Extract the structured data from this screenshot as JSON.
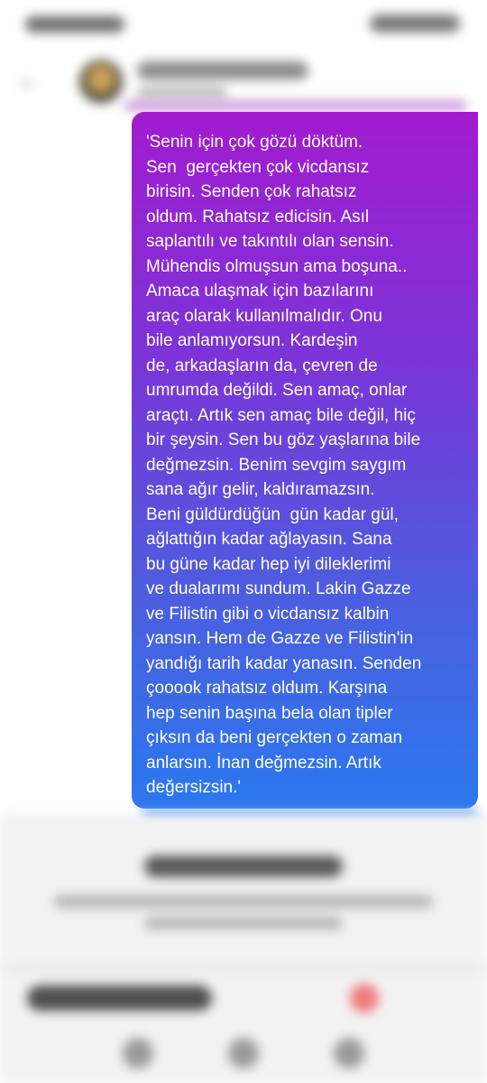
{
  "message": {
    "lines": [
      "'Senin için çok gözü döktüm.",
      "Sen  gerçekten çok vicdansız",
      "birisin. Senden çok rahatsız",
      "oldum. Rahatsız edicisin. Asıl",
      "saplantılı ve takıntılı olan sensin.",
      "Mühendis olmuşsun ama boşuna..",
      "Amaca ulaşmak için bazılarını",
      "araç olarak kullanılmalıdır. Onu",
      "bile anlamıyorsun. Kardeşin",
      "de, arkadaşların da, çevren de",
      "umrumda değildi. Sen amaç, onlar",
      "araçtı. Artık sen amaç bile değil, hiç",
      "bir şeysin. Sen bu göz yaşlarına bile",
      "değmezsin. Benim sevgim saygım",
      "sana ağır gelir, kaldıramazsın.",
      "Beni güldürdüğün  gün kadar gül,",
      "ağlattığın kadar ağlayasın. Sana",
      "bu güne kadar hep iyi dileklerimi",
      "ve dualarımı sundum. Lakin Gazze",
      "ve Filistin gibi o vicdansız kalbin",
      "yansın. Hem de Gazze ve Filistin'in",
      "yandığı tarih kadar yanasın. Senden",
      "çooook rahatsız oldum. Karşına",
      "hep senin başına bela olan tipler",
      "çıksın da beni gerçekten o zaman",
      "anlarsın. İnan değmezsin. Artık",
      "değersizsin.'"
    ]
  },
  "colors": {
    "bubble_top": "#a21bcf",
    "bubble_bottom": "#2b78ee",
    "panel_bg": "#f2f2f2"
  },
  "icons": {
    "back": "back-arrow-icon",
    "avatar": "avatar"
  }
}
